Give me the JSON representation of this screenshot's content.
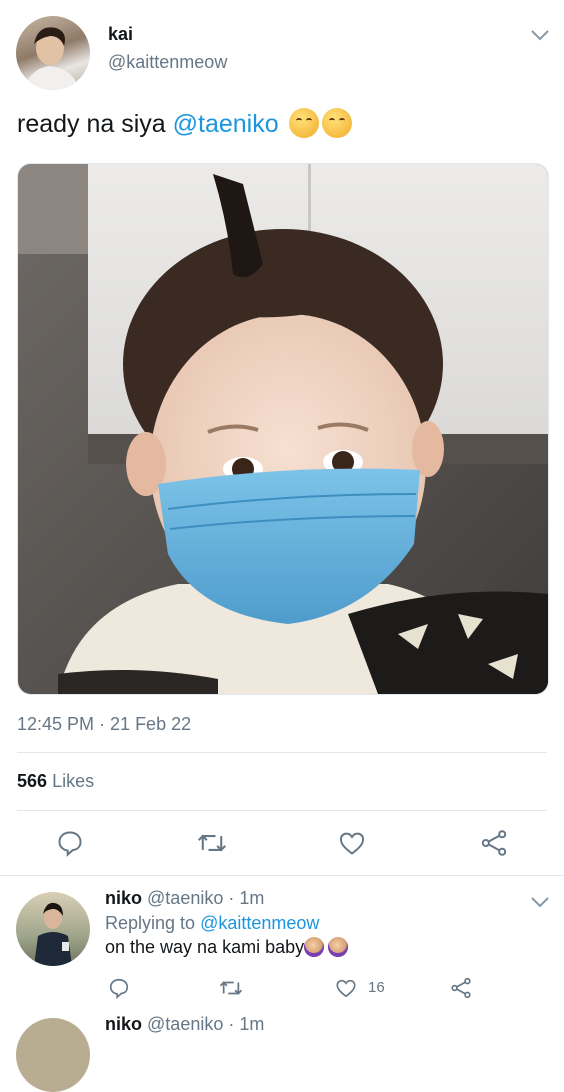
{
  "tweet": {
    "author_name": "kai",
    "author_handle": "@kaittenmeow",
    "text_prefix": "ready na siya ",
    "mention": "@taeniko",
    "emoji_1": "🤗",
    "emoji_2": "🤗",
    "timestamp": "12:45 PM · 21 Feb 22",
    "likes_count": "566",
    "likes_label": "Likes"
  },
  "reply": {
    "author_name": "niko",
    "author_handle": "@taeniko",
    "time": "· 1m",
    "replying_to_label": "Replying to",
    "replying_to_handle": "@kaittenmeow",
    "text": "on the way na kami baby",
    "emoji_1": "🙆",
    "emoji_2": "🙆",
    "like_count": "16"
  },
  "next_reply_partial": {
    "author_name": "niko",
    "author_handle": "@taeniko",
    "time": "· 1m"
  },
  "icons": [
    "chevron-down-icon",
    "reply-icon",
    "retweet-icon",
    "like-icon",
    "share-icon"
  ],
  "colors": {
    "link": "#1b95e0",
    "muted": "#657786",
    "divider": "#e1e8ed"
  }
}
